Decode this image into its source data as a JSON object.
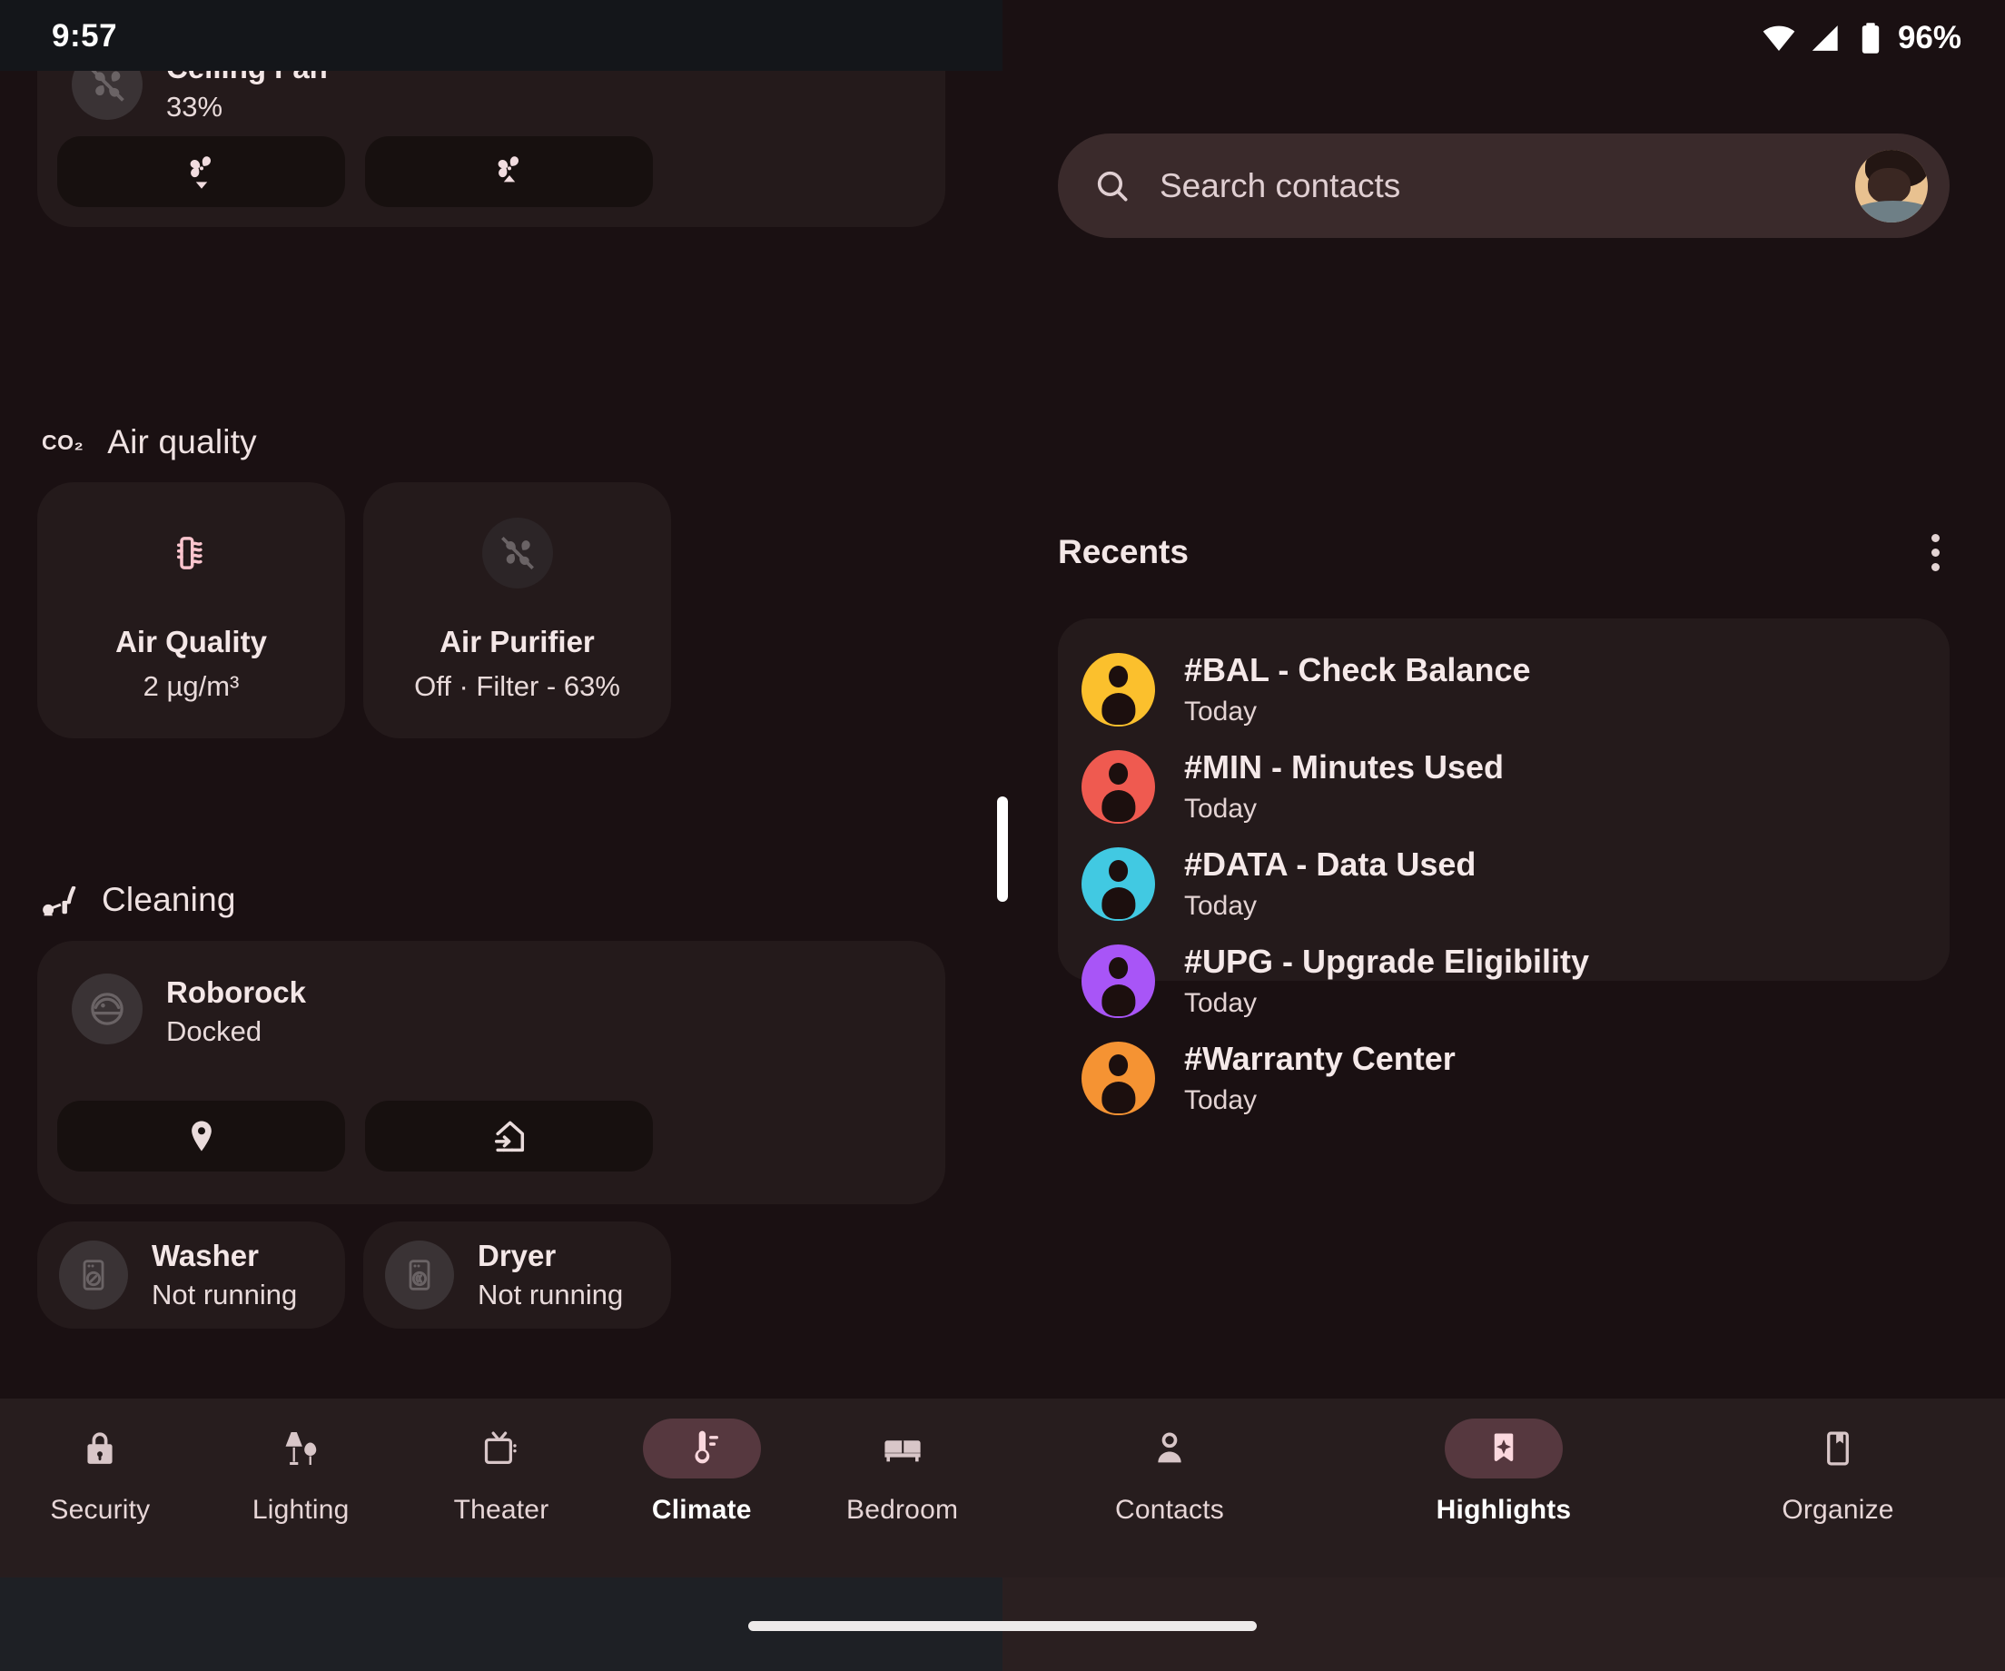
{
  "status_bar": {
    "clock": "9:57",
    "battery_percent": "96%",
    "icons": [
      "wifi-icon",
      "cellular-signal-icon",
      "battery-icon"
    ]
  },
  "left_app": {
    "fan_card": {
      "title": "Ceiling Fan",
      "value": "33%",
      "icon": "fan-off-icon",
      "buttons": [
        {
          "name": "fan-speed-down-button",
          "icon": "fan-down-icon"
        },
        {
          "name": "fan-speed-up-button",
          "icon": "fan-up-icon"
        }
      ]
    },
    "sections": [
      {
        "id": "air-quality",
        "icon": "co2-icon",
        "label": "Air quality",
        "tiles": [
          {
            "name": "Air Quality",
            "state": "2 µg/m³",
            "icon": "air-filter-icon",
            "active": true
          },
          {
            "name": "Air Purifier",
            "state": "Off · Filter - 63%",
            "icon": "fan-off-icon",
            "active": false
          }
        ]
      },
      {
        "id": "cleaning",
        "icon": "vacuum-icon",
        "label": "Cleaning",
        "vacuum": {
          "title": "Roborock",
          "state": "Docked",
          "icon": "robot-vacuum-icon",
          "buttons": [
            {
              "name": "locate-vacuum-button",
              "icon": "location-pin-icon"
            },
            {
              "name": "dock-vacuum-button",
              "icon": "return-home-icon"
            }
          ]
        },
        "appliances": [
          {
            "name": "Washer",
            "state": "Not running",
            "icon": "washer-icon"
          },
          {
            "name": "Dryer",
            "state": "Not running",
            "icon": "dryer-icon"
          }
        ]
      }
    ],
    "bottom_nav": [
      {
        "label": "Security",
        "icon": "lock-icon",
        "selected": false
      },
      {
        "label": "Lighting",
        "icon": "lamp-icon",
        "selected": false
      },
      {
        "label": "Theater",
        "icon": "tv-icon",
        "selected": false
      },
      {
        "label": "Climate",
        "icon": "thermostat-icon",
        "selected": true
      },
      {
        "label": "Bedroom",
        "icon": "bed-icon",
        "selected": false
      }
    ]
  },
  "right_app": {
    "search": {
      "placeholder": "Search contacts",
      "icon": "search-icon",
      "avatar": "user-avatar"
    },
    "recents": {
      "title": "Recents",
      "overflow_icon": "more-vert-icon",
      "items": [
        {
          "name": "#BAL - Check Balance",
          "when": "Today",
          "color": "#FBC02D"
        },
        {
          "name": "#MIN - Minutes Used",
          "when": "Today",
          "color": "#EF5A50"
        },
        {
          "name": "#DATA - Data Used",
          "when": "Today",
          "color": "#41C9E2"
        },
        {
          "name": "#UPG - Upgrade Eligibility",
          "when": "Today",
          "color": "#A855F7"
        },
        {
          "name": "#Warranty Center",
          "when": "Today",
          "color": "#F59333"
        }
      ]
    },
    "bottom_nav": [
      {
        "label": "Contacts",
        "icon": "person-icon",
        "selected": false
      },
      {
        "label": "Highlights",
        "icon": "sparkle-card-icon",
        "selected": true
      },
      {
        "label": "Organize",
        "icon": "bookmark-icon",
        "selected": false
      }
    ]
  },
  "colors": {
    "background": "#1A1012",
    "card": "#241A1B",
    "subcard": "#17100F",
    "accent_pill": "#56383F",
    "accent_icon": "#F7D4DA",
    "text_primary": "#F4E7E7",
    "text_secondary": "#E8DADA",
    "nav_bar": "#271D1E",
    "status_bar": "#14161A"
  }
}
